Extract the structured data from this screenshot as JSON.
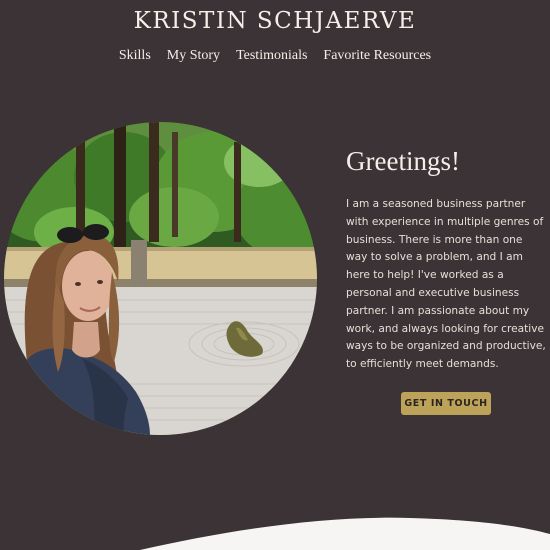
{
  "header": {
    "site_title": "KRISTIN SCHJAERVE",
    "nav": [
      {
        "label": "Skills"
      },
      {
        "label": "My Story"
      },
      {
        "label": "Testimonials"
      },
      {
        "label": "Favorite Resources"
      }
    ]
  },
  "hero": {
    "heading": "Greetings!",
    "intro": "I am a seasoned business partner with experience in multiple genres of business. There is more than one way to solve a problem, and I am here to help! I've worked as a personal and executive business partner. I am passionate about my work, and always looking for creative ways to be organized and productive, to efficiently meet demands.",
    "cta_label": "GET IN TOUCH",
    "portrait_alt": "portrait-photo"
  },
  "colors": {
    "background": "#3b3335",
    "text": "#f3efe9",
    "accent": "#bda25a",
    "wave": "#f6f5f3"
  }
}
